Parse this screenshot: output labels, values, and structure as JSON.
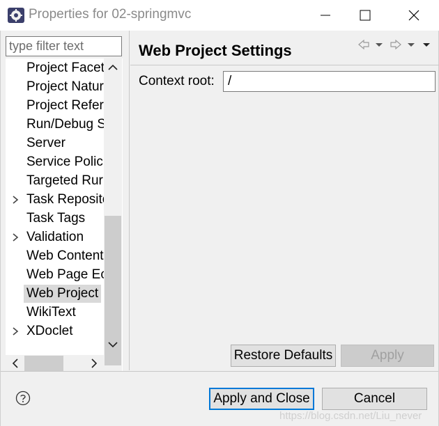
{
  "window": {
    "title": "Properties for 02-springmvc",
    "controls": [
      "minimize-icon",
      "maximize-icon",
      "close-icon"
    ]
  },
  "filter": {
    "placeholder": "type filter text",
    "value": ""
  },
  "tree": {
    "items": [
      {
        "label": "Project Facet",
        "expandable": false,
        "selected": false
      },
      {
        "label": "Project Natur",
        "expandable": false,
        "selected": false
      },
      {
        "label": "Project Refer",
        "expandable": false,
        "selected": false
      },
      {
        "label": "Run/Debug S",
        "expandable": false,
        "selected": false
      },
      {
        "label": "Server",
        "expandable": false,
        "selected": false
      },
      {
        "label": "Service Polici",
        "expandable": false,
        "selected": false
      },
      {
        "label": "Targeted Rur",
        "expandable": false,
        "selected": false
      },
      {
        "label": "Task Reposito",
        "expandable": true,
        "selected": false
      },
      {
        "label": "Task Tags",
        "expandable": false,
        "selected": false
      },
      {
        "label": "Validation",
        "expandable": true,
        "selected": false
      },
      {
        "label": "Web Content",
        "expandable": false,
        "selected": false
      },
      {
        "label": "Web Page Ec",
        "expandable": false,
        "selected": false
      },
      {
        "label": "Web Project",
        "expandable": false,
        "selected": true
      },
      {
        "label": "WikiText",
        "expandable": false,
        "selected": false
      },
      {
        "label": "XDoclet",
        "expandable": true,
        "selected": false
      }
    ]
  },
  "page": {
    "title": "Web Project Settings",
    "context_root_label": "Context root:",
    "context_root_value": "/",
    "nav_icons": [
      "back-arrow-icon",
      "back-menu-icon",
      "forward-arrow-icon",
      "forward-menu-icon",
      "view-menu-icon"
    ]
  },
  "buttons": {
    "restore_defaults": "Restore Defaults",
    "apply": "Apply",
    "apply_and_close": "Apply and Close",
    "cancel": "Cancel"
  },
  "watermark": "https://blog.csdn.net/Liu_never",
  "colors": {
    "dialog_bg": "#f0f0f0",
    "selection": "#d9d9d9",
    "focus_border": "#0078d7",
    "title_text": "#8a8a8a"
  }
}
